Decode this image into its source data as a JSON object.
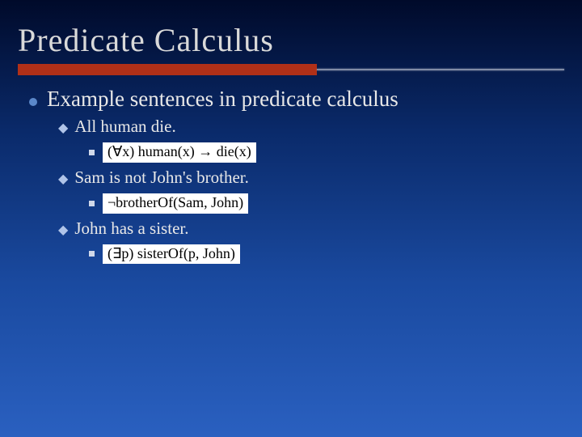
{
  "slide": {
    "title": "Predicate Calculus",
    "bullet1": "Example sentences in predicate calculus",
    "items": [
      {
        "label": "All human die.",
        "formula": "(∀x) human(x) → die(x)"
      },
      {
        "label": "Sam is not John's brother.",
        "formula": "¬brotherOf(Sam, John)"
      },
      {
        "label": "John has a sister.",
        "formula": "(∃p) sisterOf(p, John)"
      }
    ]
  }
}
